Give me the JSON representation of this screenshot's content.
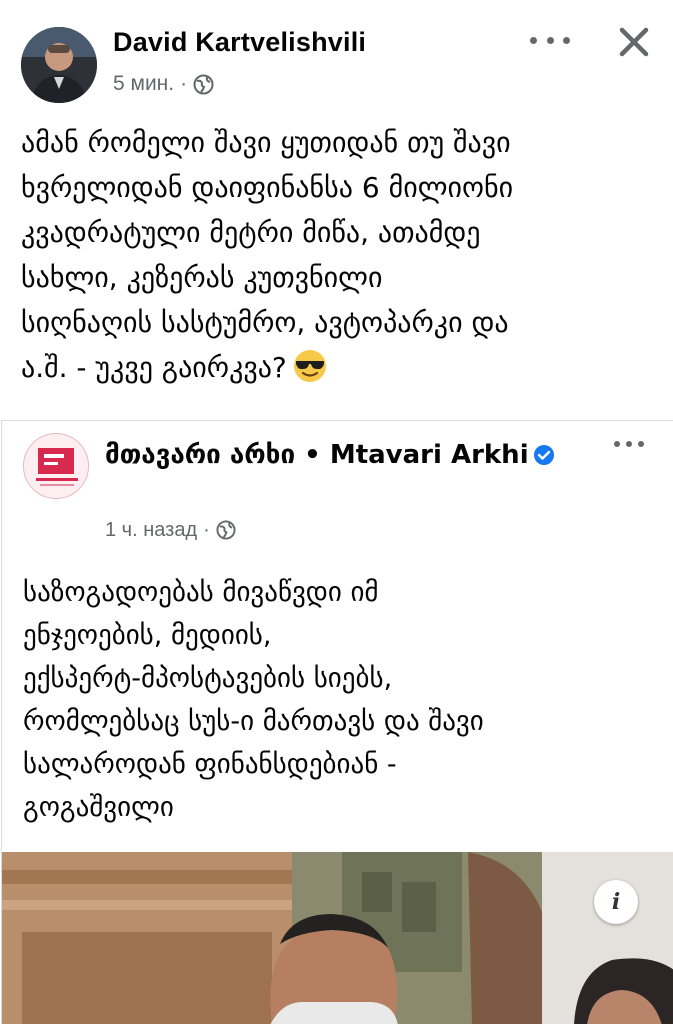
{
  "post": {
    "author": "David Kartvelishvili",
    "time": "5 мин.",
    "separator": "·",
    "text_lines": [
      "ამან რომელი შავი ყუთიდან თუ შავი",
      "ხვრელიდან დაიფინანსა 6 მილიონი",
      "კვადრატული მეტრი მიწა, ათამდე",
      "სახლი, კეზერას კუთვნილი",
      "სიღნაღის სასტუმრო, ავტოპარკი და",
      "ა.შ. - უკვე გაირკვა?"
    ],
    "emoji": "smiling-face-with-sunglasses",
    "icons": {
      "audience": "globe-icon",
      "more": "more-options-icon",
      "close": "close-icon"
    }
  },
  "shared": {
    "page_name": "მთავარი არხი • Mtavari Arkhi",
    "verified": true,
    "time": "1 ч. назад",
    "separator": "·",
    "text_lines": [
      "საზოგადოებას მივაწვდი იმ",
      "ენჯეოების, მედიის,",
      "ექსპერტ-მპოსტავების სიებს,",
      "რომლებსაც სუს-ი მართავს და შავი",
      "სალაროდან ფინანსდებიან -",
      "გოგაშვილი"
    ],
    "photo_info_label": "i"
  },
  "colors": {
    "text": "#050505",
    "secondary": "#65676b",
    "verified": "#1877f2",
    "divider": "#dadde1"
  }
}
